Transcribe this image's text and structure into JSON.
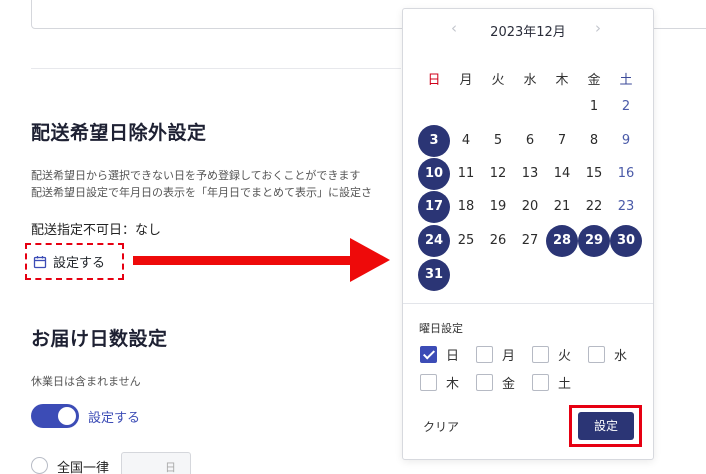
{
  "delivery_exclusion": {
    "title": "配送希望日除外設定",
    "desc_line1": "配送希望日から選択できない日を予め登録しておくことができます",
    "desc_line2": "配送希望日設定で年月日の表示を「年月日でまとめて表示」に設定さ",
    "unavailable_text": "配送指定不可日：なし",
    "set_button": "設定する",
    "set_button_icon": "calendar-icon"
  },
  "delivery_days": {
    "title": "お届け日数設定",
    "note": "休業日は含まれません",
    "toggle_label": "設定する",
    "toggle_on": true,
    "radio_label": "全国一律",
    "day_input_placeholder": "日"
  },
  "calendar": {
    "month_title": "2023年12月",
    "prev_icon": "chevron-left-icon",
    "next_icon": "chevron-right-icon",
    "prev_glyph": "‹",
    "next_glyph": "›",
    "weekdays": [
      "日",
      "月",
      "火",
      "水",
      "木",
      "金",
      "土"
    ],
    "first_weekday_index": 5,
    "days_in_month": 31,
    "selected_days": [
      3,
      10,
      17,
      24,
      28,
      29,
      30,
      31
    ],
    "weekday_setting_title": "曜日設定",
    "weekday_checkboxes": [
      {
        "label": "日",
        "checked": true
      },
      {
        "label": "月",
        "checked": false
      },
      {
        "label": "火",
        "checked": false
      },
      {
        "label": "水",
        "checked": false
      },
      {
        "label": "木",
        "checked": false
      },
      {
        "label": "金",
        "checked": false
      },
      {
        "label": "土",
        "checked": false
      }
    ],
    "clear_label": "クリア",
    "submit_label": "設定"
  },
  "colors": {
    "accent": "#3c4cb6",
    "selected_day": "#2b3575",
    "highlight_red": "#e60012",
    "sunday": "#d0021b",
    "saturday": "#3b4a99"
  }
}
